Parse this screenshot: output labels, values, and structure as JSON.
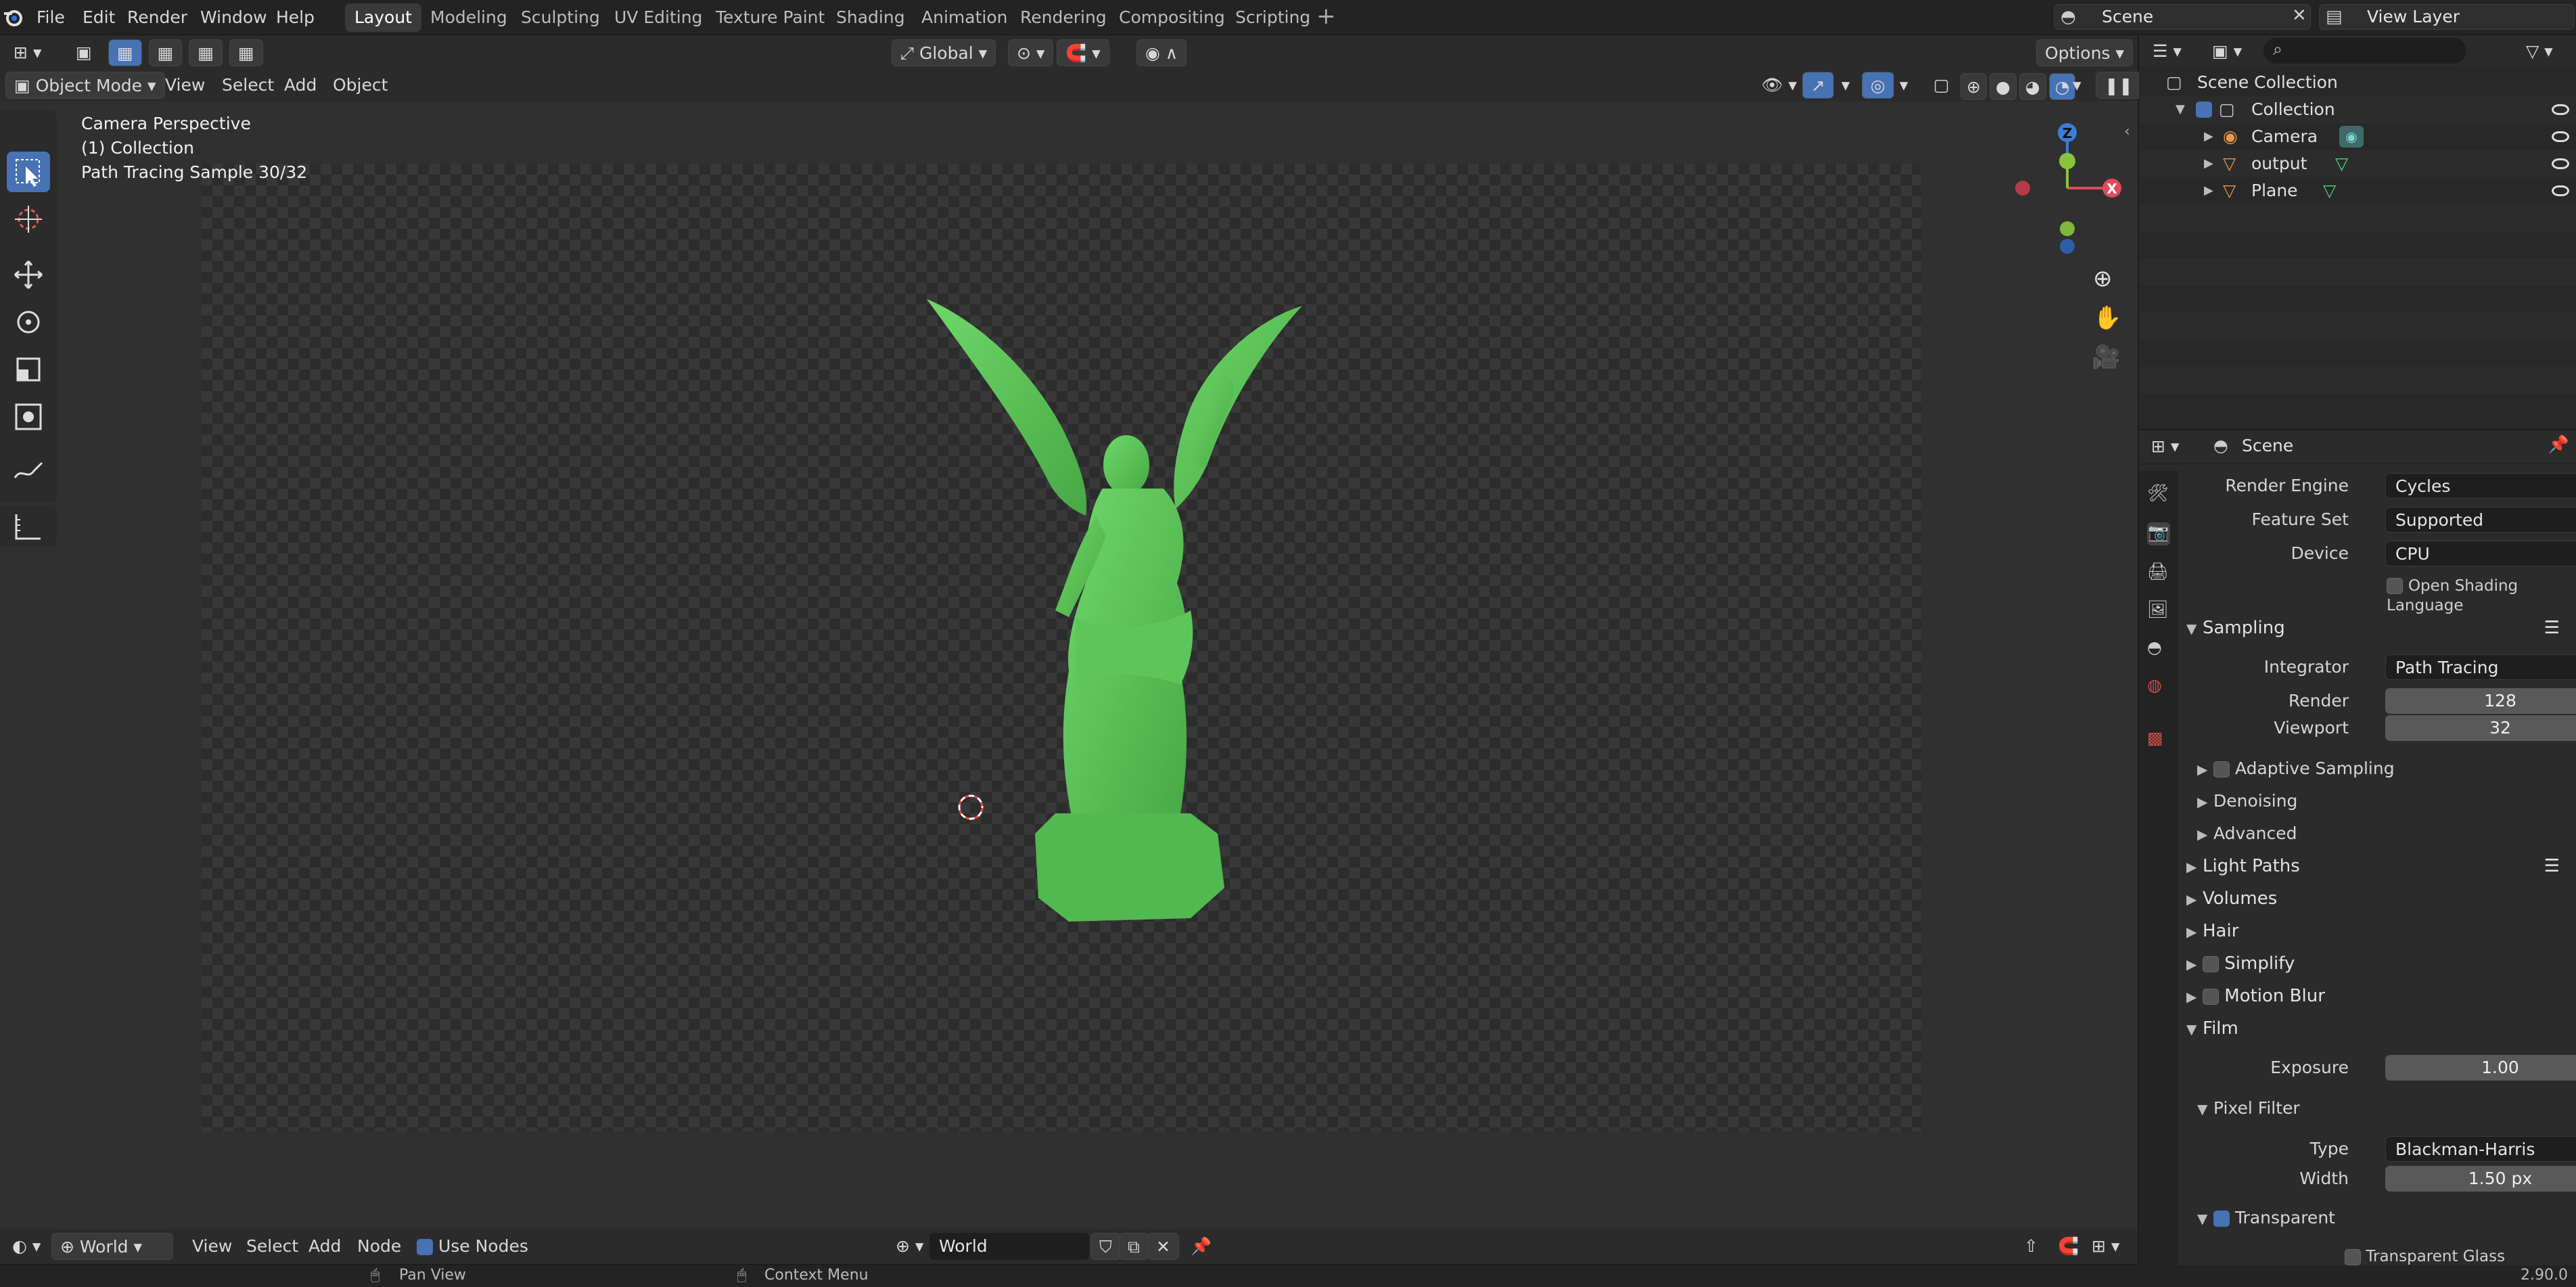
{
  "topbar": {
    "menus": [
      "File",
      "Edit",
      "Render",
      "Window",
      "Help"
    ],
    "workspaces": [
      "Layout",
      "Modeling",
      "Sculpting",
      "UV Editing",
      "Texture Paint",
      "Shading",
      "Animation",
      "Rendering",
      "Compositing",
      "Scripting"
    ],
    "active_workspace": "Layout",
    "scene_name": "Scene",
    "view_layer_name": "View Layer"
  },
  "viewport": {
    "mode": "Object Mode",
    "menus": [
      "View",
      "Select",
      "Add",
      "Object"
    ],
    "transform_orientation": "Global",
    "options_label": "Options",
    "overlay_lines": [
      "Camera Perspective",
      "(1) Collection",
      "Path Tracing Sample 30/32"
    ],
    "gizmo_axes": {
      "z": "Z",
      "x": "X"
    }
  },
  "bottombar": {
    "world_label": "World",
    "menus": [
      "View",
      "Select",
      "Add",
      "Node"
    ],
    "use_nodes_label": "Use Nodes",
    "world_field": "World"
  },
  "statusbar": {
    "left": "Pan View",
    "middle": "Context Menu",
    "version": "2.90.0"
  },
  "outliner": {
    "root": "Scene Collection",
    "collection": "Collection",
    "items": [
      "Camera",
      "output",
      "Plane"
    ]
  },
  "properties": {
    "context": "Scene",
    "render_engine": {
      "label": "Render Engine",
      "value": "Cycles"
    },
    "feature_set": {
      "label": "Feature Set",
      "value": "Supported"
    },
    "device": {
      "label": "Device",
      "value": "CPU"
    },
    "osl_label": "Open Shading Language",
    "sampling": {
      "title": "Sampling",
      "integrator": {
        "label": "Integrator",
        "value": "Path Tracing"
      },
      "render": {
        "label": "Render",
        "value": "128"
      },
      "viewport": {
        "label": "Viewport",
        "value": "32"
      },
      "adaptive": "Adaptive Sampling",
      "denoising": "Denoising",
      "advanced": "Advanced"
    },
    "sections": [
      "Light Paths",
      "Volumes",
      "Hair",
      "Simplify",
      "Motion Blur"
    ],
    "film": {
      "title": "Film",
      "exposure": {
        "label": "Exposure",
        "value": "1.00"
      },
      "pixel_filter": "Pixel Filter",
      "type": {
        "label": "Type",
        "value": "Blackman-Harris"
      },
      "width": {
        "label": "Width",
        "value": "1.50 px"
      },
      "transparent": "Transparent",
      "transparent_glass": "Transparent Glass"
    }
  },
  "colors": {
    "accent": "#4772b3",
    "statue": "#5cc65a",
    "axis_x": "#e04a5a",
    "axis_y": "#8ac43a",
    "axis_z": "#3a7ed8"
  }
}
